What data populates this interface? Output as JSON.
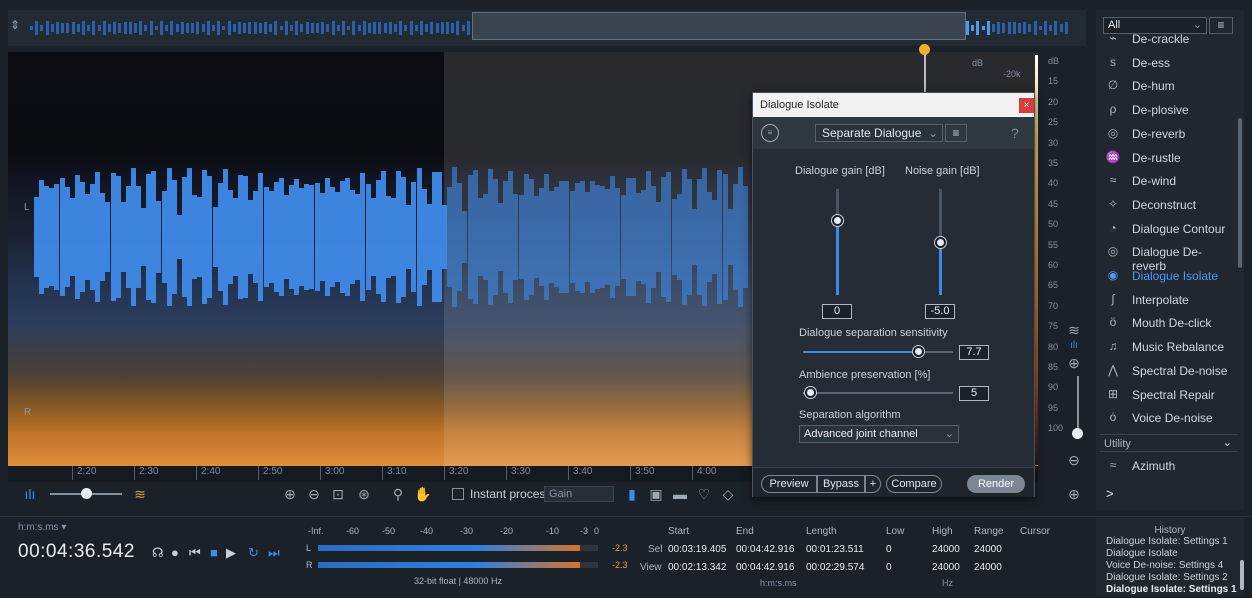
{
  "spectrogram": {
    "channels": [
      "L",
      "R"
    ],
    "time_ticks": [
      "2:20",
      "2:30",
      "2:40",
      "2:50",
      "3:00",
      "3:10",
      "3:20",
      "3:30",
      "3:40",
      "3:50",
      "4:00"
    ],
    "db_ticks": [
      "dB",
      "15",
      "20",
      "25",
      "30",
      "35",
      "40",
      "45",
      "50",
      "55",
      "60",
      "65",
      "70",
      "75",
      "80",
      "85",
      "90",
      "95",
      "100"
    ],
    "freq_labels": [
      "dB",
      "-20k"
    ]
  },
  "toolbar": {
    "instant_process": "Instant process",
    "gain_select": "Gain"
  },
  "dialog": {
    "title": "Dialogue Isolate",
    "close": "×",
    "preset": "Separate Dialogue",
    "help": "?",
    "dialogue_gain_label": "Dialogue gain [dB]",
    "noise_gain_label": "Noise gain [dB]",
    "dialogue_gain_value": "0",
    "noise_gain_value": "-5.0",
    "sensitivity_label": "Dialogue separation sensitivity",
    "sensitivity_value": "7.7",
    "ambience_label": "Ambience preservation [%]",
    "ambience_value": "5",
    "algorithm_label": "Separation algorithm",
    "algorithm_value": "Advanced joint channel",
    "preview": "Preview",
    "bypass": "Bypass",
    "plus": "+",
    "compare": "Compare",
    "render": "Render"
  },
  "modules": {
    "filter": "All",
    "items": [
      {
        "label": "De-crackle",
        "icon": "de-crackle-icon",
        "glyph": "⌁"
      },
      {
        "label": "De-ess",
        "icon": "de-ess-icon",
        "glyph": "s"
      },
      {
        "label": "De-hum",
        "icon": "de-hum-icon",
        "glyph": "∅"
      },
      {
        "label": "De-plosive",
        "icon": "de-plosive-icon",
        "glyph": "ρ"
      },
      {
        "label": "De-reverb",
        "icon": "de-reverb-icon",
        "glyph": "◎"
      },
      {
        "label": "De-rustle",
        "icon": "de-rustle-icon",
        "glyph": "♒"
      },
      {
        "label": "De-wind",
        "icon": "de-wind-icon",
        "glyph": "≈"
      },
      {
        "label": "Deconstruct",
        "icon": "deconstruct-icon",
        "glyph": "✧"
      },
      {
        "label": "Dialogue Contour",
        "icon": "dialogue-contour-icon",
        "glyph": "◔"
      },
      {
        "label": "Dialogue De-reverb",
        "icon": "dialogue-de-reverb-icon",
        "glyph": "◎"
      },
      {
        "label": "Dialogue Isolate",
        "icon": "dialogue-isolate-icon",
        "glyph": "◉"
      },
      {
        "label": "Interpolate",
        "icon": "interpolate-icon",
        "glyph": "∫"
      },
      {
        "label": "Mouth De-click",
        "icon": "mouth-de-click-icon",
        "glyph": "ö"
      },
      {
        "label": "Music Rebalance",
        "icon": "music-rebalance-icon",
        "glyph": "♫"
      },
      {
        "label": "Spectral De-noise",
        "icon": "spectral-de-noise-icon",
        "glyph": "⋀"
      },
      {
        "label": "Spectral Repair",
        "icon": "spectral-repair-icon",
        "glyph": "⊞"
      },
      {
        "label": "Voice De-noise",
        "icon": "voice-de-noise-icon",
        "glyph": "ȯ"
      }
    ],
    "utility_header": "Utility",
    "utility_items": [
      {
        "label": "Azimuth",
        "icon": "azimuth-icon",
        "glyph": "≈"
      }
    ],
    "more": ">"
  },
  "transport": {
    "time_format": "h:m:s.ms ▾",
    "time": "00:04:36.542"
  },
  "meters": {
    "headers": [
      "-Inf.",
      "-60",
      "-50",
      "-40",
      "-30",
      "-20",
      "-10",
      "-3",
      "0"
    ],
    "left_label": "L",
    "right_label": "R",
    "left_peak": "-2.3",
    "right_peak": "-2.3",
    "format": "32-bit float | 48000 Hz"
  },
  "selection": {
    "headers": [
      "Start",
      "End",
      "Length",
      "Low",
      "High",
      "Range",
      "Cursor"
    ],
    "sel_label": "Sel",
    "view_label": "View",
    "sel": [
      "00:03:19.405",
      "00:04:42.916",
      "00:01:23.511",
      "0",
      "24000",
      "24000"
    ],
    "view": [
      "00:02:13.342",
      "00:04:42.916",
      "00:02:29.574",
      "0",
      "24000",
      "24000"
    ],
    "time_unit": "h:m:s.ms",
    "freq_unit": "Hz"
  },
  "history": {
    "title": "History",
    "items": [
      {
        "label": "Dialogue Isolate: Settings 1",
        "bold": false
      },
      {
        "label": "Dialogue Isolate",
        "bold": false
      },
      {
        "label": "Voice De-noise: Settings 4",
        "bold": false
      },
      {
        "label": "Dialogue Isolate: Settings 2",
        "bold": false
      },
      {
        "label": "Dialogue Isolate: Settings 1",
        "bold": true
      }
    ]
  }
}
